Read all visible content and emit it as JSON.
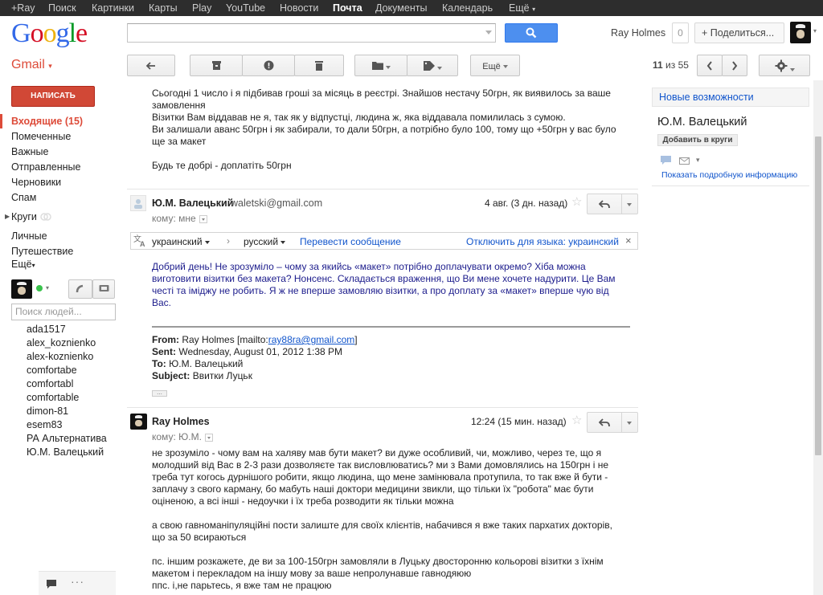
{
  "topbar": {
    "items": [
      "+Ray",
      "Поиск",
      "Картинки",
      "Карты",
      "Play",
      "YouTube",
      "Новости",
      "Почта",
      "Документы",
      "Календарь",
      "Ещё"
    ],
    "active": "Почта"
  },
  "header": {
    "logo": "Google",
    "search_value": "",
    "user_name": "Ray Holmes",
    "notification_count": "0",
    "share_label": "+ Поделиться..."
  },
  "gmail": {
    "label": "Gmail",
    "toolbar": {
      "more_label": "Ещё"
    },
    "pager": {
      "current": "11",
      "separator": "из",
      "total": "55"
    }
  },
  "sidebar": {
    "compose_label": "НАПИСАТЬ",
    "folders": [
      "Входящие (15)",
      "Помеченные",
      "Важные",
      "Отправленные",
      "Черновики",
      "Спам"
    ],
    "circles_label": "Круги",
    "labels": [
      "Личные",
      "Путешествие"
    ],
    "more_label": "Ещё",
    "people_search_placeholder": "Поиск людей...",
    "contacts": [
      "ada1517",
      "alex_koznienko",
      "alex-koznienko",
      "comfortabe",
      "comfortabl",
      "comfortable",
      "dimon-81",
      "esem83",
      "РА Альтернатива",
      "Ю.М. Валецький"
    ]
  },
  "thread": {
    "prev_message": {
      "lines": [
        "Сьогодні 1 число і я підбивав гроші за місяць в реєстрі. Знайшов нестачу 50грн, як виявилось за ваше",
        "замовлення",
        "Візитки Вам віддавав не я, так як у відпустці, людина ж, яка віддавала помилилась з сумою.",
        "Ви залишали аванс 50грн і як забирали, то дали 50грн, а потрібно було 100, тому що +50грн у вас було",
        "ще за макет",
        "",
        "Будь те добрі - доплатіть 50грн"
      ]
    },
    "message1": {
      "sender": "Ю.М. Валецький",
      "email": "waletski@gmail.com",
      "date": "4 авг. (3 дн. назад)",
      "to": "кому: мне",
      "translate": {
        "from_lang": "украинский",
        "to_lang": "русский",
        "translate_link": "Перевести сообщение",
        "disable_link": "Отключить для языка: украинский"
      },
      "body_lines": [
        "Добрий день! Не зрозуміло – чому за якийсь «макет» потрібно доплачувати окремо? Хіба можна",
        "виготовити візитки без макета? Нонсенс. Складається враження, що Ви мене хочете надурити. Це Вам",
        "честі та іміджу не робить. Я ж не вперше замовляю візитки, а про доплату за «макет» вперше чую від",
        "Вас."
      ],
      "quoted": {
        "from_label": "From:",
        "from_value": "Ray Holmes [mailto:",
        "from_link": "ray88ra@gmail.com",
        "from_end": "]",
        "sent_label": "Sent:",
        "sent_value": "Wednesday, August 01, 2012 1:38 PM",
        "to_label": "To:",
        "to_value": "Ю.М. Валецький",
        "subject_label": "Subject:",
        "subject_value": "Ввитки Луцьк"
      }
    },
    "message2": {
      "sender": "Ray Holmes",
      "date": "12:24 (15 мин. назад)",
      "to": "кому: Ю.М.",
      "body_lines": [
        "не зрозуміло - чому вам на халяву мав бути макет? ви дуже особливий, чи, можливо, через те, що я",
        "молодший від Вас в 2-3 рази дозволяєте так висловлюватись? ми з Вами домовлялись на 150грн і не",
        "треба тут когось дурнішого робити, якщо людина, що мене замінювала протупила, то так вже й бути -",
        "заплачу з свого карману, бо мабуть наші доктори медицини звикли, що тільки їх \"робота\" має бути",
        "оціненою, а всі інші - недоучки і їх треба розводити як тільки можна",
        "",
        "а свою гавноманіпуляційні пости залиште для своїх клієнтів, набачився я вже таких пархатих докторів,",
        "що за 50 всираються",
        "",
        "пс. іншим розкажете, де ви за 100-150грн замовляли в Луцьку двосторонню кольорові візитки з їхнім",
        "макетом і перекладом на іншу мову за ваше непролунавше гавнодяюю",
        "ппс. і,не парьтесь, я вже там не працюю"
      ]
    }
  },
  "right_panel": {
    "whats_new": "Новые возможности",
    "contact_name": "Ю.М. Валецький",
    "add_to_circles": "Добавить в круги",
    "show_info": "Показать подробную информацию"
  },
  "colors": {
    "gmail_red": "#dd4b39",
    "compose_red": "#d14836",
    "search_blue": "#4d8fef",
    "link_blue": "#1155cc",
    "online_green": "#3ac24c"
  }
}
